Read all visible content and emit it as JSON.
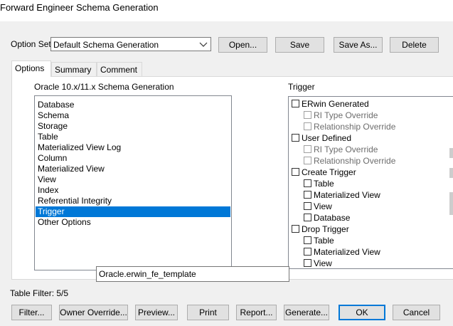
{
  "window": {
    "title": "Forward Engineer Schema Generation"
  },
  "option_set": {
    "label": "Option Set:",
    "value": "Default Schema Generation",
    "buttons": {
      "open": "Open...",
      "save": "Save",
      "save_as": "Save As...",
      "delete": "Delete"
    }
  },
  "tabs": [
    {
      "label": "Options",
      "active": true
    },
    {
      "label": "Summary",
      "active": false
    },
    {
      "label": "Comment",
      "active": false
    }
  ],
  "schema": {
    "heading": "Oracle 10.x/11.x Schema Generation",
    "items": [
      "Database",
      "Schema",
      "Storage",
      "Table",
      "Materialized View Log",
      "Column",
      "Materialized View",
      "View",
      "Index",
      "Referential Integrity",
      "Trigger",
      "Other Options"
    ],
    "selected": "Trigger"
  },
  "trigger": {
    "heading": "Trigger",
    "tree": [
      {
        "label": "ERwin Generated",
        "level": 0,
        "checked": false,
        "disabled": false
      },
      {
        "label": "RI Type Override",
        "level": 1,
        "checked": false,
        "disabled": true
      },
      {
        "label": "Relationship Override",
        "level": 1,
        "checked": false,
        "disabled": true
      },
      {
        "label": "User Defined",
        "level": 0,
        "checked": false,
        "disabled": false
      },
      {
        "label": "RI Type Override",
        "level": 1,
        "checked": false,
        "disabled": true
      },
      {
        "label": "Relationship Override",
        "level": 1,
        "checked": false,
        "disabled": true
      },
      {
        "label": "Create Trigger",
        "level": 0,
        "checked": false,
        "disabled": false
      },
      {
        "label": "Table",
        "level": 1,
        "checked": false,
        "disabled": false
      },
      {
        "label": "Materialized View",
        "level": 1,
        "checked": false,
        "disabled": false
      },
      {
        "label": "View",
        "level": 1,
        "checked": false,
        "disabled": false
      },
      {
        "label": "Database",
        "level": 1,
        "checked": false,
        "disabled": false
      },
      {
        "label": "Drop Trigger",
        "level": 0,
        "checked": false,
        "disabled": false
      },
      {
        "label": "Table",
        "level": 1,
        "checked": false,
        "disabled": false
      },
      {
        "label": "Materialized View",
        "level": 1,
        "checked": false,
        "disabled": false
      },
      {
        "label": "View",
        "level": 1,
        "checked": false,
        "disabled": false
      }
    ]
  },
  "tooltip": {
    "text": "Oracle.erwin_fe_template"
  },
  "table_filter": {
    "text": "Table Filter: 5/5"
  },
  "bottom_buttons": {
    "filter": "Filter...",
    "owner_override": "Owner Override...",
    "preview": "Preview...",
    "print": "Print",
    "report": "Report...",
    "generate": "Generate...",
    "ok": "OK",
    "cancel": "Cancel"
  },
  "colors": {
    "selection": "#0078d7",
    "default_button_border": "#0078d7",
    "dialog_bg": "#f0f0f0"
  }
}
